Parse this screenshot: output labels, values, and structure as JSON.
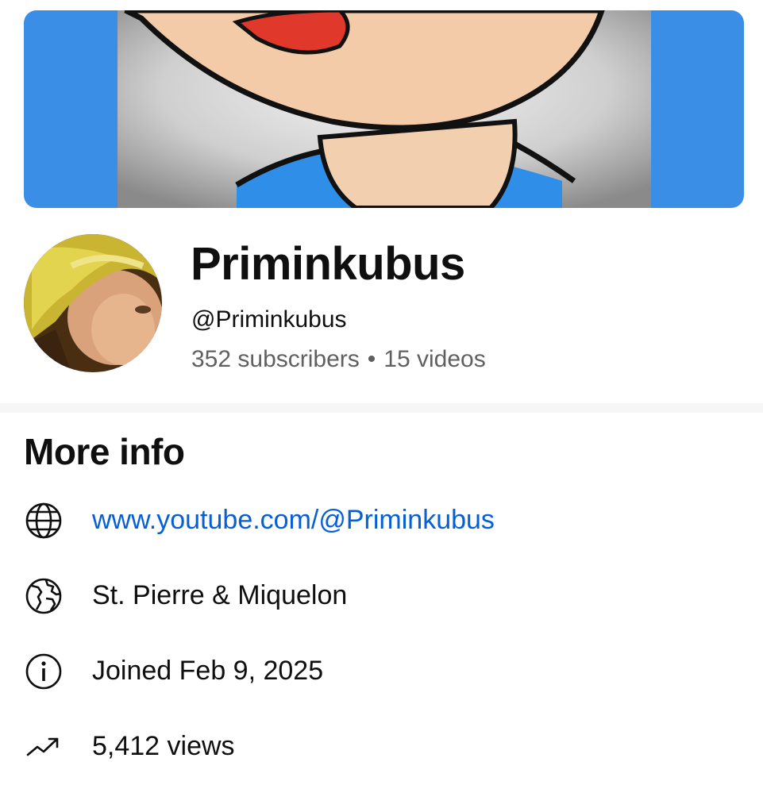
{
  "colors": {
    "banner_side": "#3a8ee6",
    "link": "#065fd4",
    "secondary_text": "#606060"
  },
  "banner": {
    "image": "cartoon-face-banner"
  },
  "channel": {
    "avatar": "channel-avatar-photo",
    "name": "Priminkubus",
    "handle": "@Priminkubus",
    "subscribers": "352 subscribers",
    "separator": "•",
    "videos": "15 videos"
  },
  "more_info": {
    "title": "More info",
    "items": [
      {
        "icon": "globe-icon",
        "text": "www.youtube.com/@Priminkubus"
      },
      {
        "icon": "country-globe-icon",
        "text": "St. Pierre & Miquelon"
      },
      {
        "icon": "info-icon",
        "text": "Joined Feb 9, 2025"
      },
      {
        "icon": "trending-up-icon",
        "text": "5,412 views"
      }
    ]
  }
}
